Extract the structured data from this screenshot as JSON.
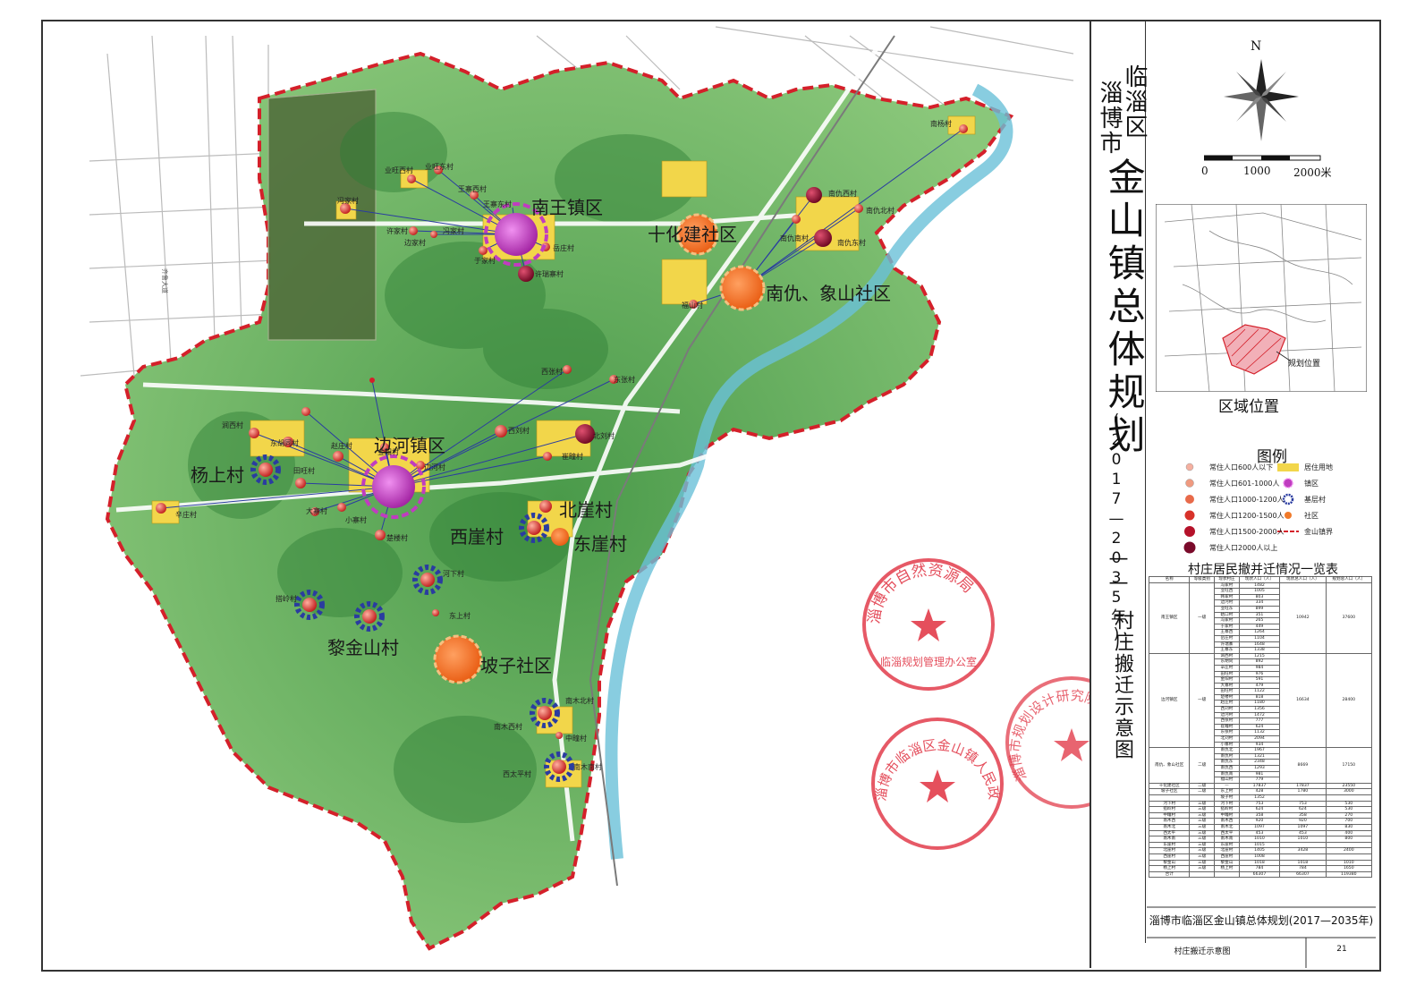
{
  "title": {
    "city": "淄博市",
    "district": "临淄区",
    "main": "金山镇总体规划",
    "period": "(2017—2035年)",
    "dash": "——",
    "subtitle": "村庄搬迁示意图"
  },
  "compass": {
    "north": "N"
  },
  "scale": {
    "zero": "0",
    "mid": "1000",
    "end": "2000米"
  },
  "location_map": {
    "marker_label": "规划位置",
    "caption": "区域位置"
  },
  "legend": {
    "title": "图例",
    "items": [
      {
        "label": "常住人口600人以下",
        "color": "#f5b0a0"
      },
      {
        "label": "常住人口601-1000人",
        "color": "#ef9a80"
      },
      {
        "label": "常住人口1000-1200人",
        "color": "#e86a4a"
      },
      {
        "label": "常住人口1200-1500人",
        "color": "#d8322a"
      },
      {
        "label": "常住人口1500-2000人",
        "color": "#b5122a"
      },
      {
        "label": "常住人口2000人以上",
        "color": "#7a0a2a"
      },
      {
        "label": "居住用地",
        "color": "#f2d64a"
      },
      {
        "label": "镇区",
        "color": "#c03cc0"
      },
      {
        "label": "基层村",
        "color": "#2a3ca0"
      },
      {
        "label": "社区",
        "color": "#f07a2a"
      },
      {
        "label": "金山镇界",
        "color": "#d4202a"
      }
    ]
  },
  "table": {
    "title": "村庄居民撤并迁情况一览表",
    "headers": [
      "名称",
      "等级类别",
      "现状村庄",
      "现状人口（人）",
      "现状总人口（人）",
      "规划总人口（人）"
    ],
    "groups": [
      {
        "name": "南王镇区",
        "level": "一级",
        "total_now": "10942",
        "total_plan": "37600",
        "rows": [
          [
            "冯家村",
            "1482"
          ],
          [
            "业旺西",
            "1005"
          ],
          [
            "韩家村",
            "803"
          ],
          [
            "边河村",
            "334"
          ],
          [
            "业旺东",
            "899"
          ],
          [
            "姑口村",
            "351"
          ],
          [
            "冯家村",
            "265"
          ],
          [
            "于家村",
            "449"
          ],
          [
            "王寨西",
            "1264"
          ],
          [
            "岳庄村",
            "1104"
          ],
          [
            "许瑞寨",
            "1648"
          ],
          [
            "王寨东",
            "1338"
          ]
        ]
      },
      {
        "name": "边河镇区",
        "level": "一级",
        "total_now": "16634",
        "total_plan": "28400",
        "rows": [
          [
            "涧西村",
            "1215"
          ],
          [
            "东胡同",
            "892"
          ],
          [
            "辛庄村",
            "984"
          ],
          [
            "田旺村",
            "976"
          ],
          [
            "金阳村",
            "591"
          ],
          [
            "大寨村",
            "479"
          ],
          [
            "田旺村",
            "1122"
          ],
          [
            "楚楼村",
            "818"
          ],
          [
            "赵庄村",
            "1180"
          ],
          [
            "西刘村",
            "1356"
          ],
          [
            "边河村",
            "1472"
          ],
          [
            "西张村",
            "777"
          ],
          [
            "崔疃村",
            "624"
          ],
          [
            "东张村",
            "1132"
          ],
          [
            "北刘村",
            "2094"
          ],
          [
            "小寨村",
            "934"
          ]
        ]
      },
      {
        "name": "南仇、象山社区",
        "level": "二级",
        "total_now": "8669",
        "total_plan": "17150",
        "rows": [
          [
            "南仇北",
            "1967"
          ],
          [
            "南仇村",
            "1321"
          ],
          [
            "南仇东",
            "2348"
          ],
          [
            "南仇西",
            "1293"
          ],
          [
            "南仇南",
            "981"
          ],
          [
            "福山村",
            "779"
          ]
        ]
      }
    ],
    "rows": [
      [
        "十化建社区",
        "二级",
        "—",
        "17837",
        "17837",
        "23550"
      ],
      [
        "坡子社区",
        "二级",
        "东上村",
        "428",
        "1780",
        "3000"
      ],
      [
        "",
        "",
        "坡子村",
        "1352",
        "",
        ""
      ],
      [
        "河下村",
        "三级",
        "河下村",
        "753",
        "753",
        "530"
      ],
      [
        "搭岭村",
        "三级",
        "搭岭村",
        "624",
        "624",
        "530"
      ],
      [
        "中疃村",
        "三级",
        "中疃村",
        "358",
        "358",
        "270"
      ],
      [
        "南木西",
        "三级",
        "南木西",
        "920",
        "920",
        "700"
      ],
      [
        "南木北",
        "三级",
        "南木北",
        "1097",
        "1097",
        "830"
      ],
      [
        "西太平",
        "三级",
        "西太平",
        "453",
        "453",
        "400"
      ],
      [
        "南木南",
        "三级",
        "南木南",
        "1010",
        "1010",
        "800"
      ],
      [
        "东崖村",
        "三级",
        "东崖村",
        "1015",
        "",
        ""
      ],
      [
        "北崖村",
        "三级",
        "北崖村",
        "1405",
        "3428",
        "2400"
      ],
      [
        "西崖村",
        "三级",
        "西崖村",
        "1008",
        "",
        ""
      ],
      [
        "黎金山",
        "三级",
        "黎金山",
        "1018",
        "1018",
        "1010"
      ],
      [
        "杨上村",
        "三级",
        "杨上村",
        "784",
        "784",
        "1650"
      ],
      [
        "合计",
        "",
        "",
        "66307",
        "66307",
        "119380"
      ]
    ]
  },
  "footer": {
    "title": "淄博市临淄区金山镇总体规划(2017—2035年)",
    "sheet": "村庄搬迁示意图",
    "page": "21"
  },
  "map_labels": {
    "major": [
      "南王镇区",
      "十化建社区",
      "南仇、象山社区",
      "边河镇区",
      "杨上村",
      "北崖村",
      "西崖村",
      "东崖村",
      "黎金山村",
      "坡子社区"
    ],
    "minor": [
      "业旺西村",
      "业旺东村",
      "冯家村",
      "王寨西村",
      "王寨东村",
      "许家村",
      "边家村",
      "冯家村",
      "于家村",
      "岳庄村",
      "许瑞寨村",
      "南仇西村",
      "南仇北村",
      "南仇南村",
      "南仇东村",
      "福山村",
      "南杨村",
      "西张村",
      "东张村",
      "涧西村",
      "东胡同村",
      "金阳村",
      "边河村",
      "赵庄村",
      "田旺村",
      "西刘村",
      "北刘村",
      "崔疃村",
      "辛庄村",
      "大寨村",
      "小寨村",
      "楚楼村",
      "河下村",
      "东上村",
      "搭岭村",
      "南木北村",
      "南木西村",
      "中疃村",
      "西太平村",
      "南木南村"
    ],
    "road": "齐鲁大道"
  },
  "stamps": [
    {
      "org": "淄博市自然资源局",
      "sub": "临淄规划管理办公室"
    },
    {
      "org": "淄博市临淄区金山镇人民政府",
      "sub": ""
    },
    {
      "org": "淄博市规划设计研究院",
      "sub": ""
    }
  ]
}
